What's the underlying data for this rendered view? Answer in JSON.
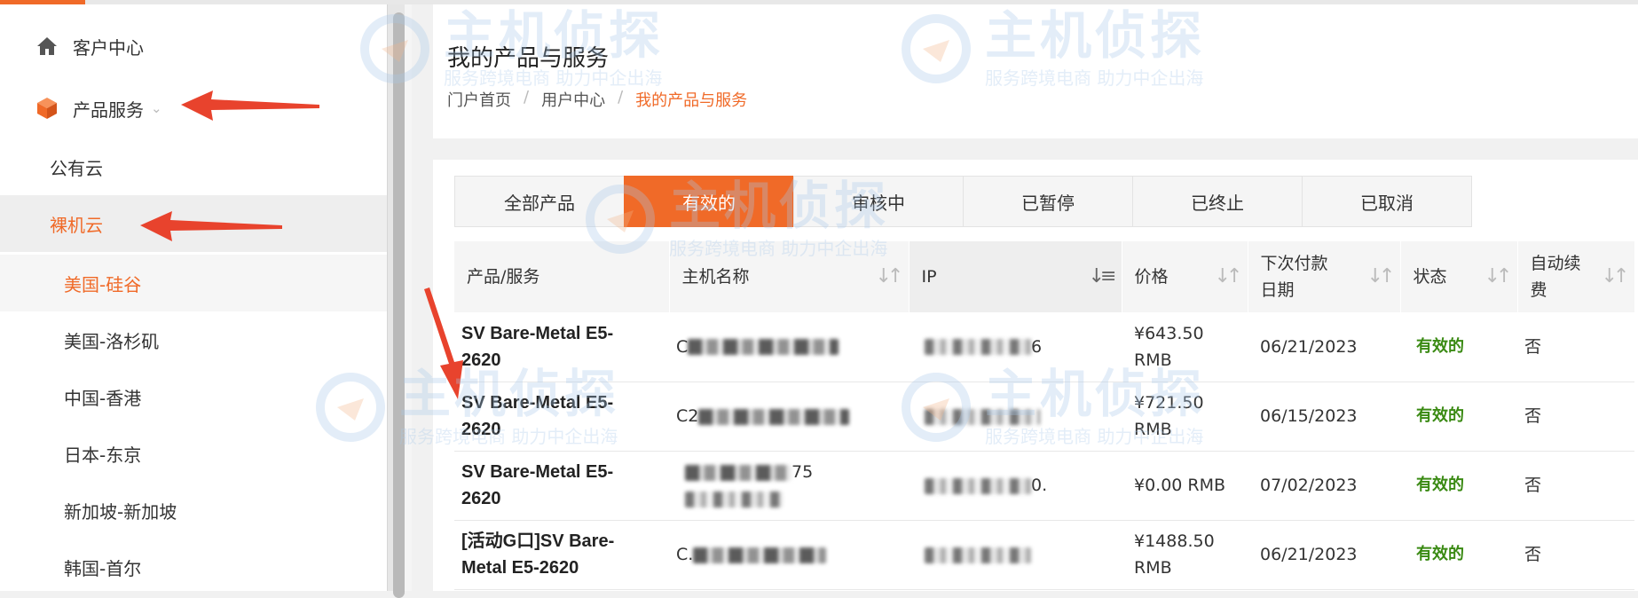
{
  "sidebar": {
    "home_label": "客户中心",
    "product_label": "产品服务",
    "public_cloud": "公有云",
    "bare_metal": "裸机云",
    "regions": [
      "美国-硅谷",
      "美国-洛杉矶",
      "中国-香港",
      "日本-东京",
      "新加坡-新加坡",
      "韩国-首尔"
    ]
  },
  "header": {
    "title": "我的产品与服务",
    "breadcrumb": {
      "home": "门户首页",
      "user_center": "用户中心",
      "current": "我的产品与服务",
      "separator": "/"
    }
  },
  "tabs": [
    "全部产品",
    "有效的",
    "审核中",
    "已暂停",
    "已终止",
    "已取消"
  ],
  "active_tab": "有效的",
  "table": {
    "columns": {
      "product": "产品/服务",
      "hostname": "主机名称",
      "ip": "IP",
      "price": "价格",
      "next_payment_1": "下次付款",
      "next_payment_2": "日期",
      "status": "状态",
      "auto_renew_1": "自动续",
      "auto_renew_2": "费"
    },
    "rows": [
      {
        "product_1": "SV Bare-Metal E5-",
        "product_2": "2620",
        "hostname_partial": "C",
        "ip_partial": "6",
        "price_1": "¥643.50",
        "price_2": "RMB",
        "date": "06/21/2023",
        "status": "有效的",
        "auto_renew": "否"
      },
      {
        "product_1": "SV Bare-Metal E5-",
        "product_2": "2620",
        "hostname_partial": "C2",
        "ip_partial": "",
        "price_1": "¥721.50",
        "price_2": "RMB",
        "date": "06/15/2023",
        "status": "有效的",
        "auto_renew": "否"
      },
      {
        "product_1": "SV Bare-Metal E5-",
        "product_2": "2620",
        "hostname_partial": "75",
        "ip_partial": "0.",
        "price_1": "¥0.00 RMB",
        "price_2": "",
        "date": "07/02/2023",
        "status": "有效的",
        "auto_renew": "否"
      },
      {
        "product_1": "[活动G口]SV Bare-",
        "product_2": "Metal E5-2620",
        "hostname_partial": "C.",
        "ip_partial": "",
        "price_1": "¥1488.50",
        "price_2": "RMB",
        "date": "06/21/2023",
        "status": "有效的",
        "auto_renew": "否"
      }
    ]
  },
  "watermark": {
    "brand": "主机侦探",
    "slogan": "服务跨境电商 助力中企出海"
  },
  "colors": {
    "accent": "#f06a28",
    "status_green": "#3a8a13",
    "annotation_arrow": "#e8432d"
  }
}
